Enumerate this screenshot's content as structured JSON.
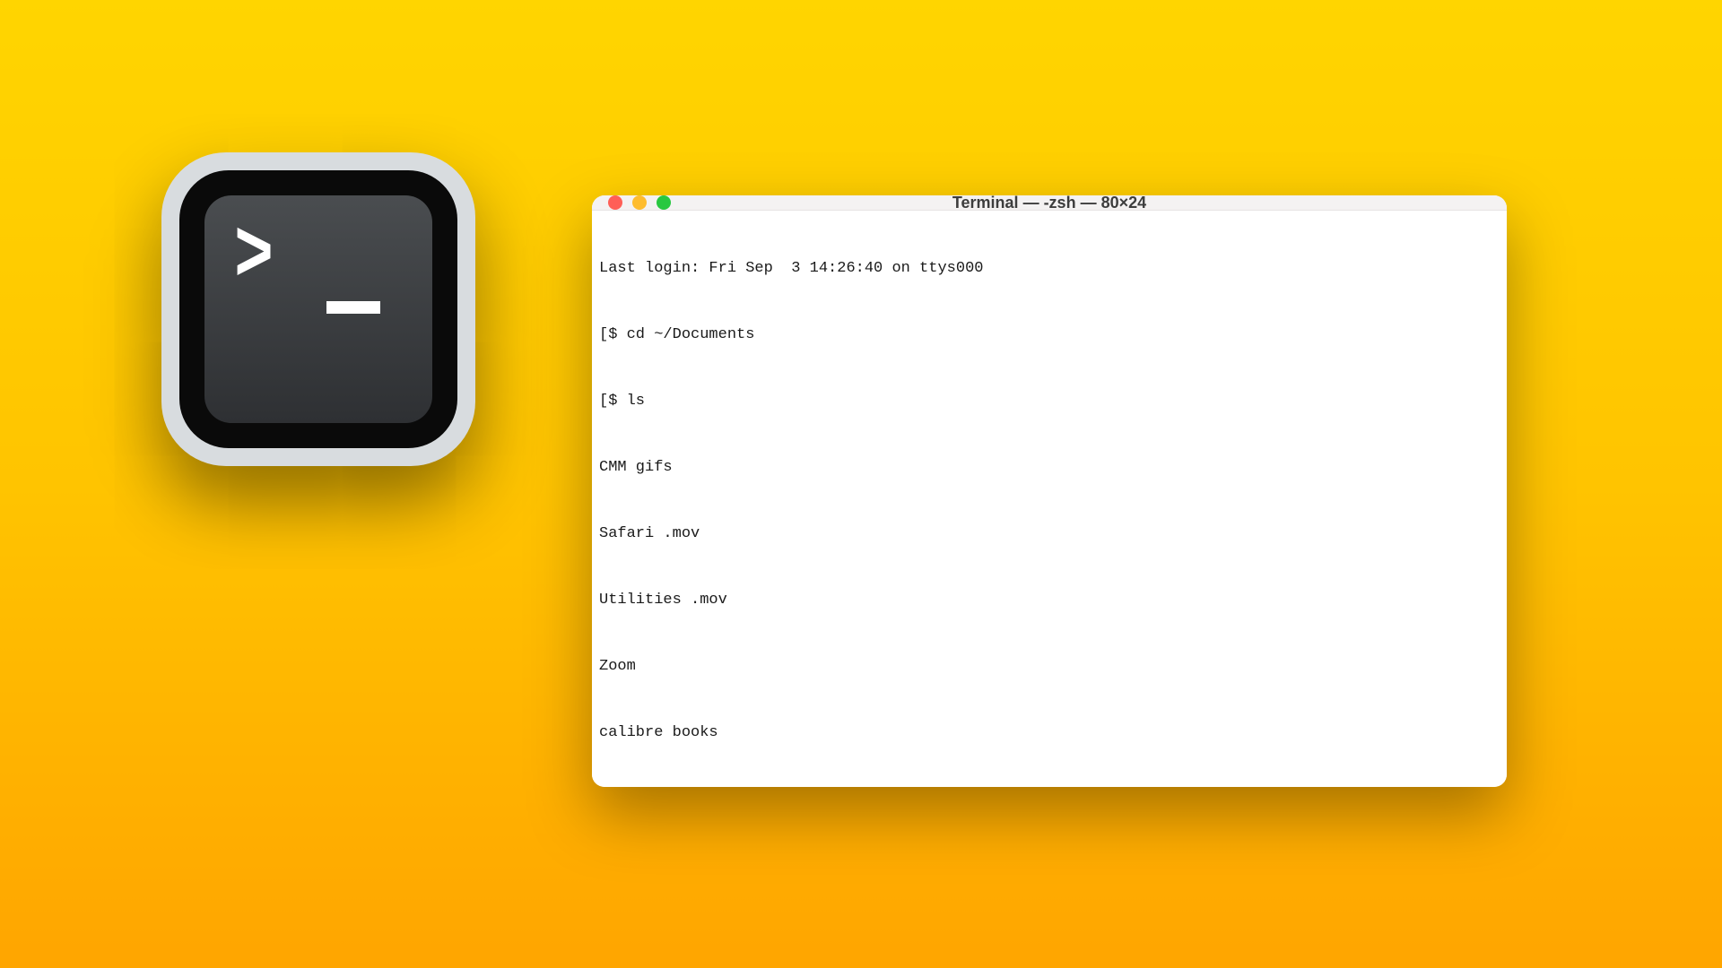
{
  "window": {
    "title": "Terminal — -zsh — 80×24"
  },
  "terminal": {
    "lines": [
      "Last login: Fri Sep  3 14:26:40 on ttys000",
      "[$ cd ~/Documents",
      "[$ ls",
      "CMM gifs",
      "Safari .mov",
      "Utilities .mov",
      "Zoom",
      "calibre books"
    ],
    "prompt": "$ "
  }
}
